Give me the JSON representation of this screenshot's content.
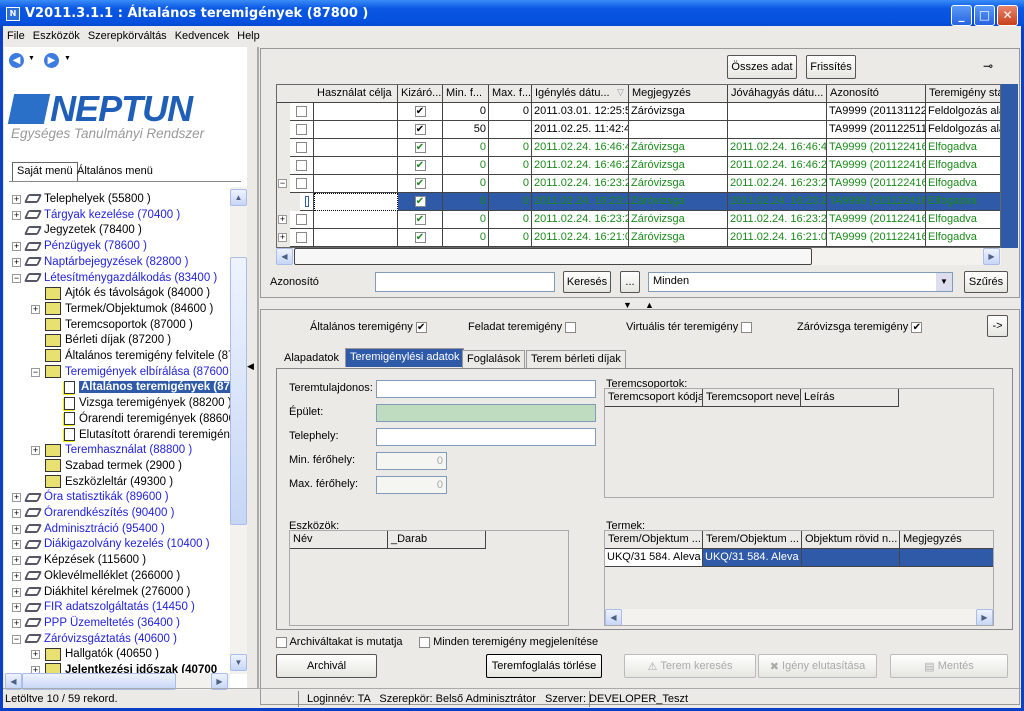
{
  "window": {
    "title": "V2011.3.1.1 : Általános teremigények (87800  )",
    "minimize": "_",
    "maximize": "□",
    "close": "✕"
  },
  "menu": [
    "File",
    "Eszközök",
    "Szerepkörváltás",
    "Kedvencek",
    "Help"
  ],
  "nav": {
    "back_icon": "back-arrow-icon",
    "forward_icon": "forward-arrow-icon"
  },
  "logo": {
    "name": "NEPTUN",
    "subtitle": "Egységes Tanulmányi Rendszer"
  },
  "left_tabs": [
    "Saját menü",
    "Általános menü"
  ],
  "tree": [
    {
      "label": "Telephelyek (55800  )",
      "level": 0,
      "exp": "+",
      "icon": "book",
      "blue": false
    },
    {
      "label": "Tárgyak kezelése (70400  )",
      "level": 0,
      "exp": "+",
      "icon": "book",
      "blue": true
    },
    {
      "label": "Jegyzetek (78400  )",
      "level": 0,
      "exp": "",
      "icon": "book",
      "blue": false
    },
    {
      "label": "Pénzügyek (78600  )",
      "level": 0,
      "exp": "+",
      "icon": "book",
      "blue": true
    },
    {
      "label": "Naptárbejegyzések (82800  )",
      "level": 0,
      "exp": "+",
      "icon": "book",
      "blue": true
    },
    {
      "label": "Létesítménygazdálkodás (83400  )",
      "level": 0,
      "exp": "−",
      "icon": "book",
      "blue": true
    },
    {
      "label": "Ajtók és távolságok (84000  )",
      "level": 1,
      "exp": "",
      "icon": "page",
      "blue": false
    },
    {
      "label": "Termek/Objektumok (84600  )",
      "level": 1,
      "exp": "+",
      "icon": "page",
      "blue": false
    },
    {
      "label": "Teremcsoportok (87000  )",
      "level": 1,
      "exp": "",
      "icon": "page",
      "blue": false
    },
    {
      "label": "Bérleti díjak (87200  )",
      "level": 1,
      "exp": "",
      "icon": "page",
      "blue": false
    },
    {
      "label": "Általános teremigény felvitele (87400",
      "level": 1,
      "exp": "",
      "icon": "page",
      "blue": false
    },
    {
      "label": "Teremigények elbírálása (87600  )",
      "level": 1,
      "exp": "−",
      "icon": "page",
      "blue": true
    },
    {
      "label": "Általános teremigények (87",
      "level": 2,
      "exp": "",
      "icon": "doc",
      "blue": false,
      "selected": true
    },
    {
      "label": "Vizsga teremigények (88200  )",
      "level": 2,
      "exp": "",
      "icon": "doc",
      "blue": false
    },
    {
      "label": "Órarendi teremigények (88600  )",
      "level": 2,
      "exp": "",
      "icon": "doc",
      "blue": false
    },
    {
      "label": "Elutasított órarendi teremigénye",
      "level": 2,
      "exp": "",
      "icon": "doc",
      "blue": false
    },
    {
      "label": "Teremhasználat (88800  )",
      "level": 1,
      "exp": "+",
      "icon": "page",
      "blue": true
    },
    {
      "label": "Szabad termek (2900  )",
      "level": 1,
      "exp": "",
      "icon": "page",
      "blue": false
    },
    {
      "label": "Eszközleltár (49300  )",
      "level": 1,
      "exp": "",
      "icon": "page",
      "blue": false
    },
    {
      "label": "Óra statisztikák (89600  )",
      "level": 0,
      "exp": "+",
      "icon": "book",
      "blue": true
    },
    {
      "label": "Órarendkészítés (90400  )",
      "level": 0,
      "exp": "+",
      "icon": "book",
      "blue": true
    },
    {
      "label": "Adminisztráció (95400  )",
      "level": 0,
      "exp": "+",
      "icon": "book",
      "blue": true
    },
    {
      "label": "Diákigazolvány kezelés (10400  )",
      "level": 0,
      "exp": "+",
      "icon": "book",
      "blue": true
    },
    {
      "label": "Képzések (115600  )",
      "level": 0,
      "exp": "+",
      "icon": "book",
      "blue": false
    },
    {
      "label": "Oklevélmelléklet (266000  )",
      "level": 0,
      "exp": "+",
      "icon": "book",
      "blue": false
    },
    {
      "label": "Diákhitel kérelmek (276000  )",
      "level": 0,
      "exp": "+",
      "icon": "book",
      "blue": false
    },
    {
      "label": "FIR adatszolgáltatás (14450  )",
      "level": 0,
      "exp": "+",
      "icon": "book",
      "blue": true
    },
    {
      "label": "PPP Üzemeltetés (36400  )",
      "level": 0,
      "exp": "+",
      "icon": "book",
      "blue": true
    },
    {
      "label": "Záróvizsgáztatás (40600  )",
      "level": 0,
      "exp": "−",
      "icon": "book",
      "blue": true
    },
    {
      "label": "Hallgatók (40650  )",
      "level": 1,
      "exp": "+",
      "icon": "page",
      "blue": false
    },
    {
      "label": "Jelentkezési időszak (40700",
      "level": 1,
      "exp": "+",
      "icon": "page",
      "blue": false,
      "bold": true
    }
  ],
  "toolbar": {
    "all_data": "Összes adat",
    "refresh": "Frissítés"
  },
  "grid": {
    "columns": [
      "",
      "",
      "Használat célja",
      "Kizáró...",
      "Min. f...",
      "Max. f...",
      "Igénylés dátu...",
      "Megjegyzés",
      "Jóváhagyás dátu...",
      "Azonosító",
      "Teremigény stá"
    ],
    "rows": [
      {
        "exp": "",
        "excl": true,
        "min": "0",
        "max": "0",
        "req": "2011.03.01. 12:25:5",
        "note": "Záróvizsga",
        "appr": "",
        "id": "TA9999 (201131122",
        "status": "Feldolgozás ala",
        "green": false
      },
      {
        "exp": "",
        "excl": true,
        "min": "50",
        "max": "",
        "req": "2011.02.25. 11:42:4",
        "note": "",
        "appr": "",
        "id": "TA9999 (201122511",
        "status": "Feldolgozás ala",
        "green": false
      },
      {
        "exp": "",
        "excl": true,
        "min": "0",
        "max": "0",
        "req": "2011.02.24. 16:46:4",
        "note": "Záróvizsga",
        "appr": "2011.02.24. 16:46:4",
        "id": "TA9999 (201122416",
        "status": "Elfogadva",
        "green": true
      },
      {
        "exp": "",
        "excl": true,
        "min": "0",
        "max": "0",
        "req": "2011.02.24. 16:46:2",
        "note": "Záróvizsga",
        "appr": "2011.02.24. 16:46:2",
        "id": "TA9999 (201122416",
        "status": "Elfogadva",
        "green": true
      },
      {
        "exp": "−",
        "excl": true,
        "min": "0",
        "max": "0",
        "req": "2011.02.24. 16:23:2",
        "note": "Záróvizsga",
        "appr": "2011.02.24. 16:23:2",
        "id": "TA9999 (201122416",
        "status": "Elfogadva",
        "green": true
      },
      {
        "exp": "",
        "excl": true,
        "min": "0",
        "max": "0",
        "req": "2011.02.24. 16:23:2",
        "note": "Záróvizsga",
        "appr": "2011.02.24. 16:23:2",
        "id": "TA9999 (201122416",
        "status": "Elfogadva",
        "green": true,
        "selected": true
      },
      {
        "exp": "+",
        "excl": true,
        "min": "0",
        "max": "0",
        "req": "2011.02.24. 16:23:2",
        "note": "Záróvizsga",
        "appr": "2011.02.24. 16:23:2",
        "id": "TA9999 (201122416",
        "status": "Elfogadva",
        "green": true
      },
      {
        "exp": "+",
        "excl": true,
        "min": "0",
        "max": "0",
        "req": "2011.02.24. 16:21:0",
        "note": "Záróvizsga",
        "appr": "2011.02.24. 16:21:0",
        "id": "TA9999 (201122416",
        "status": "Elfogadva",
        "green": true
      }
    ]
  },
  "search": {
    "label": "Azonosító",
    "value": "",
    "button": "Keresés",
    "dots": "...",
    "filter_value": "Minden",
    "filter_button": "Szűrés"
  },
  "types": [
    {
      "label": "Általános teremigény",
      "checked": true
    },
    {
      "label": "Feladat teremigény",
      "checked": false
    },
    {
      "label": "Virtuális tér teremigény",
      "checked": false
    },
    {
      "label": "Záróvizsga teremigény",
      "checked": true
    }
  ],
  "arrow_button": "->",
  "detail_tabs": [
    "Alapadatok",
    "Teremigénylési adatok",
    "Foglalások",
    "Terem bérleti díjak"
  ],
  "form": {
    "owner": "Teremtulajdonos:",
    "building": "Épület:",
    "site": "Telephely:",
    "min": "Min. férőhely:",
    "min_value": "0",
    "max": "Max. férőhely:",
    "max_value": "0"
  },
  "groups": {
    "label": "Teremcsoportok:",
    "columns": [
      "Teremcsoport kódja",
      "Teremcsoport neve",
      "Leírás"
    ]
  },
  "tools": {
    "label": "Eszközök:",
    "columns": [
      "Név",
      "_Darab"
    ]
  },
  "rooms": {
    "label": "Termek:",
    "columns": [
      "Terem/Objektum ...",
      "Terem/Objektum ...",
      "Objektum rövid n...",
      "Megjegyzés"
    ],
    "row": [
      "UKQ/31 584. Aleva",
      "UKQ/31 584. Aleva",
      "",
      ""
    ]
  },
  "bottom": {
    "archived": "Archiváltakat is mutatja",
    "all": "Minden teremigény megjelenítése",
    "archive": "Archivál",
    "delete": "Teremfoglalás törlése",
    "search_room": "Terem keresés",
    "reject": "Igény elutasítása",
    "save": "Mentés"
  },
  "status": {
    "records": "Letöltve 10 / 59 rekord.",
    "login": "Loginnév: TA   Szerepkör: Belső Adminisztrátor   Szerver: DEVELOPER_Teszt"
  }
}
